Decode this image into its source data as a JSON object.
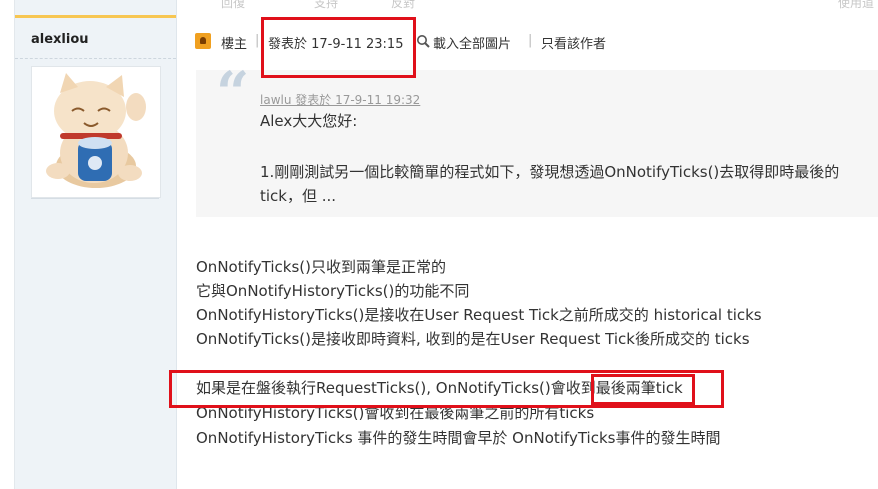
{
  "top_strip": {
    "item1": "回復",
    "item2": "支持",
    "item3": "反對",
    "item4": "使用道"
  },
  "sidebar": {
    "username": "alexliou",
    "avatar_alt": "lucky-cat avatar"
  },
  "post_meta": {
    "owner_label": "樓主",
    "separator": "|",
    "posted_at": "發表於 17-9-11 23:15",
    "load_images": "載入全部圖片",
    "author_only": "只看該作者"
  },
  "quote": {
    "header": "lawlu 發表於 17-9-11 19:32",
    "line1": "Alex大大您好:",
    "line2": "1.剛剛測試另一個比較簡單的程式如下，發現想透過OnNotifyTicks()去取得即時最後的tick，但 ..."
  },
  "body": {
    "lines": [
      "OnNotifyTicks()只收到兩筆是正常的",
      "它與OnNotifyHistoryTicks()的功能不同",
      "OnNotifyHistoryTicks()是接收在User Request Tick之前所成交的 historical ticks",
      "OnNotifyTicks()是接收即時資料, 收到的是在User Request Tick後所成交的 ticks",
      "如果是在盤後執行RequestTicks(), OnNotifyTicks()會收到最後兩筆tick",
      "OnNotifyHistoryTicks()會收到在最後兩筆之前的所有ticks",
      "OnNotifyHistoryTicks 事件的發生時間會早於 OnNotifyTicks事件的發生時間"
    ]
  },
  "colors": {
    "highlight": "#e0101a",
    "sidebar_accent": "#f7c652",
    "sidebar_bg": "#eef3f7"
  }
}
